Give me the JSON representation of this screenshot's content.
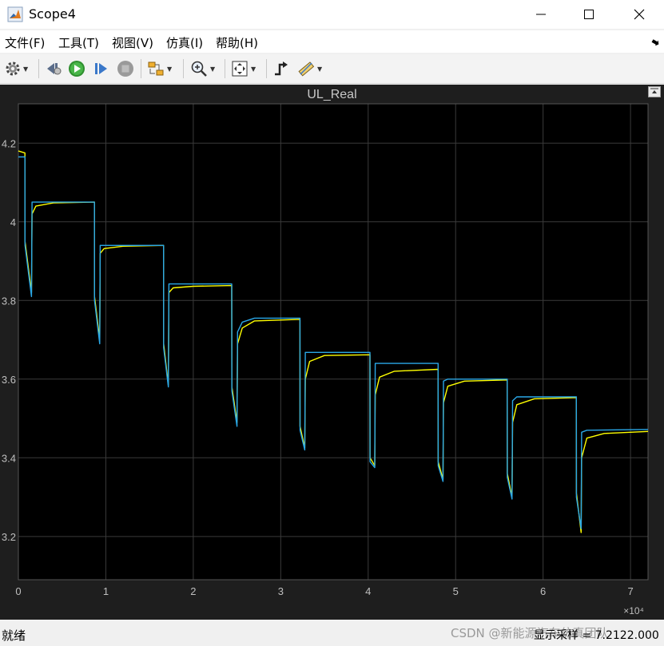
{
  "window": {
    "title": "Scope4"
  },
  "menu": [
    {
      "label": "文件(F)"
    },
    {
      "label": "工具(T)"
    },
    {
      "label": "视图(V)"
    },
    {
      "label": "仿真(I)"
    },
    {
      "label": "帮助(H)"
    }
  ],
  "toolbar": {
    "icons": [
      "gear-icon",
      "dropdown",
      "step-back-icon",
      "run-icon",
      "step-forward-icon",
      "stop-icon",
      "highlight-block-icon",
      "dropdown",
      "zoom-in-icon",
      "dropdown",
      "autoscale-icon",
      "dropdown",
      "triggers-icon",
      "measurements-icon",
      "dropdown"
    ]
  },
  "plot": {
    "title": "UL_Real",
    "exponent_label": "×10⁴"
  },
  "status": {
    "left": "就绪",
    "right": "显示采样 = 7.2122.000",
    "watermark": "CSDN @新能源汽车仿真团队"
  },
  "colors": {
    "background": "#000000",
    "panel": "#1e1e1e",
    "grid": "#3a3a3a",
    "axis_text": "#bfbfbf",
    "series1": "#ffff00",
    "series2": "#2aa8e8"
  },
  "chart_data": {
    "type": "line",
    "title": "UL_Real",
    "xlabel": "",
    "ylabel": "",
    "xlim": [
      0,
      72000
    ],
    "ylim": [
      3.09,
      4.3
    ],
    "x_ticks": [
      0,
      10000,
      20000,
      30000,
      40000,
      50000,
      60000,
      70000
    ],
    "x_tick_labels": [
      "0",
      "1",
      "2",
      "3",
      "4",
      "5",
      "6",
      "7"
    ],
    "x_multiplier": "×10⁴",
    "y_ticks": [
      3.2,
      3.4,
      3.6,
      3.8,
      4.0,
      4.2
    ],
    "y_tick_labels": [
      "3.2",
      "3.4",
      "3.6",
      "3.8",
      "4",
      "4.2"
    ],
    "grid": true,
    "series": [
      {
        "color": "#ffff00",
        "points": [
          [
            0,
            4.18
          ],
          [
            750,
            4.175
          ],
          [
            760,
            3.95
          ],
          [
            1500,
            3.82
          ],
          [
            1560,
            4.02
          ],
          [
            2000,
            4.04
          ],
          [
            4000,
            4.048
          ],
          [
            8700,
            4.05
          ],
          [
            8710,
            3.81
          ],
          [
            9300,
            3.7
          ],
          [
            9360,
            3.92
          ],
          [
            9800,
            3.932
          ],
          [
            12000,
            3.938
          ],
          [
            16600,
            3.94
          ],
          [
            16610,
            3.69
          ],
          [
            17150,
            3.585
          ],
          [
            17210,
            3.82
          ],
          [
            17700,
            3.832
          ],
          [
            20000,
            3.836
          ],
          [
            24400,
            3.838
          ],
          [
            24410,
            3.58
          ],
          [
            25000,
            3.49
          ],
          [
            25060,
            3.69
          ],
          [
            25600,
            3.73
          ],
          [
            27000,
            3.748
          ],
          [
            32200,
            3.752
          ],
          [
            32210,
            3.48
          ],
          [
            32750,
            3.425
          ],
          [
            32810,
            3.6
          ],
          [
            33300,
            3.645
          ],
          [
            35000,
            3.66
          ],
          [
            40200,
            3.662
          ],
          [
            40210,
            3.4
          ],
          [
            40750,
            3.38
          ],
          [
            40810,
            3.56
          ],
          [
            41300,
            3.605
          ],
          [
            43000,
            3.62
          ],
          [
            48000,
            3.625
          ],
          [
            48010,
            3.39
          ],
          [
            48550,
            3.345
          ],
          [
            48610,
            3.54
          ],
          [
            49100,
            3.582
          ],
          [
            51000,
            3.595
          ],
          [
            55900,
            3.598
          ],
          [
            55910,
            3.36
          ],
          [
            56450,
            3.3
          ],
          [
            56510,
            3.49
          ],
          [
            57000,
            3.535
          ],
          [
            59000,
            3.55
          ],
          [
            63800,
            3.553
          ],
          [
            63810,
            3.31
          ],
          [
            64350,
            3.21
          ],
          [
            64410,
            3.4
          ],
          [
            65000,
            3.45
          ],
          [
            67000,
            3.462
          ],
          [
            72000,
            3.467
          ]
        ]
      },
      {
        "color": "#2aa8e8",
        "points": [
          [
            0,
            4.165
          ],
          [
            750,
            4.165
          ],
          [
            760,
            3.94
          ],
          [
            1500,
            3.81
          ],
          [
            1560,
            4.05
          ],
          [
            2000,
            4.05
          ],
          [
            8700,
            4.05
          ],
          [
            8710,
            3.8
          ],
          [
            9300,
            3.69
          ],
          [
            9360,
            3.94
          ],
          [
            16600,
            3.94
          ],
          [
            16610,
            3.68
          ],
          [
            17150,
            3.58
          ],
          [
            17210,
            3.842
          ],
          [
            24400,
            3.842
          ],
          [
            24410,
            3.57
          ],
          [
            25000,
            3.48
          ],
          [
            25060,
            3.72
          ],
          [
            25600,
            3.745
          ],
          [
            27000,
            3.755
          ],
          [
            32200,
            3.755
          ],
          [
            32210,
            3.47
          ],
          [
            32750,
            3.42
          ],
          [
            32810,
            3.668
          ],
          [
            40200,
            3.668
          ],
          [
            40210,
            3.39
          ],
          [
            40750,
            3.375
          ],
          [
            40810,
            3.64
          ],
          [
            48000,
            3.64
          ],
          [
            48010,
            3.38
          ],
          [
            48550,
            3.34
          ],
          [
            48610,
            3.595
          ],
          [
            49100,
            3.6
          ],
          [
            55900,
            3.6
          ],
          [
            55910,
            3.35
          ],
          [
            56450,
            3.295
          ],
          [
            56510,
            3.545
          ],
          [
            57000,
            3.555
          ],
          [
            63800,
            3.555
          ],
          [
            63810,
            3.3
          ],
          [
            64350,
            3.22
          ],
          [
            64410,
            3.465
          ],
          [
            65000,
            3.47
          ],
          [
            72000,
            3.472
          ]
        ]
      }
    ]
  }
}
